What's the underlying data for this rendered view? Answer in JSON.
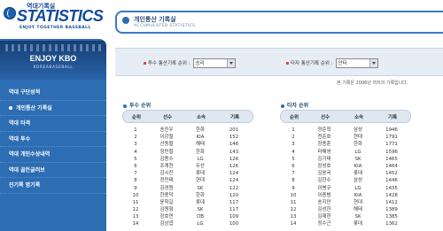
{
  "logo": {
    "small_text": "역대기록실",
    "big_text": "STATISTICS",
    "tagline": "ENJOY TOGETHER BASEBALL"
  },
  "sidebar": {
    "title": "ENJOY KBO",
    "subtitle": "KOREABASEBALL",
    "items": [
      {
        "label": "역대 구단성적"
      },
      {
        "label": "개인통산 기록실"
      },
      {
        "label": "역대 타격"
      },
      {
        "label": "역대 투수"
      },
      {
        "label": "역대 개인수상내역"
      },
      {
        "label": "역대 골든글러브"
      },
      {
        "label": "진기록 명기록"
      }
    ]
  },
  "header": {
    "title": "개인통산 기록실",
    "subtitle": "ACCUMULATED STATISTICS"
  },
  "filters": {
    "pitcher_label": "투수 통산기록 순위 :",
    "pitcher_value": "승리",
    "batter_label": "타자 통산기록 순위 :",
    "batter_value": "안타"
  },
  "note": "본 기록은 2006년 까지의 기록입니다.",
  "pitcher_table": {
    "title": "투수 순위",
    "headers": [
      "순위",
      "선수",
      "소속",
      "기록"
    ],
    "rows": [
      [
        "1",
        "송진우",
        "한화",
        "201"
      ],
      [
        "2",
        "이강철",
        "KIA",
        "152"
      ],
      [
        "3",
        "선동렬",
        "해태",
        "146"
      ],
      [
        "4",
        "정민철",
        "한화",
        "143"
      ],
      [
        "5",
        "김용수",
        "LG",
        "126"
      ],
      [
        "6",
        "조계현",
        "두산",
        "126"
      ],
      [
        "7",
        "김시진",
        "롯데",
        "124"
      ],
      [
        "8",
        "정민태",
        "현대",
        "124"
      ],
      [
        "9",
        "김경원",
        "SK",
        "122"
      ],
      [
        "10",
        "한용덕",
        "한화",
        "120"
      ],
      [
        "11",
        "윤학길",
        "롯데",
        "117"
      ],
      [
        "12",
        "김원형",
        "SK",
        "117"
      ],
      [
        "13",
        "장호연",
        "OB",
        "109"
      ],
      [
        "14",
        "김상엽",
        "LG",
        "100"
      ]
    ]
  },
  "batter_table": {
    "title": "타자 순위",
    "headers": [
      "순위",
      "선수",
      "소속",
      "기록"
    ],
    "rows": [
      [
        "1",
        "양준혁",
        "삼성",
        "1946"
      ],
      [
        "2",
        "전준호",
        "현대",
        "1791"
      ],
      [
        "3",
        "장종훈",
        "한화",
        "1771"
      ],
      [
        "4",
        "마해영",
        "LG",
        "1596"
      ],
      [
        "5",
        "김기태",
        "SK",
        "1465"
      ],
      [
        "6",
        "장성호",
        "KIA",
        "1464"
      ],
      [
        "7",
        "김응국",
        "롯데",
        "1452"
      ],
      [
        "8",
        "김한수",
        "삼성",
        "1446"
      ],
      [
        "9",
        "이병규",
        "LG",
        "1435"
      ],
      [
        "10",
        "이종범",
        "KIA",
        "1428"
      ],
      [
        "11",
        "송지만",
        "현대",
        "1412"
      ],
      [
        "12",
        "김성한",
        "해태",
        "1389"
      ],
      [
        "13",
        "김재현",
        "SK",
        "1385"
      ],
      [
        "14",
        "정수근",
        "롯데",
        "1362"
      ]
    ]
  }
}
